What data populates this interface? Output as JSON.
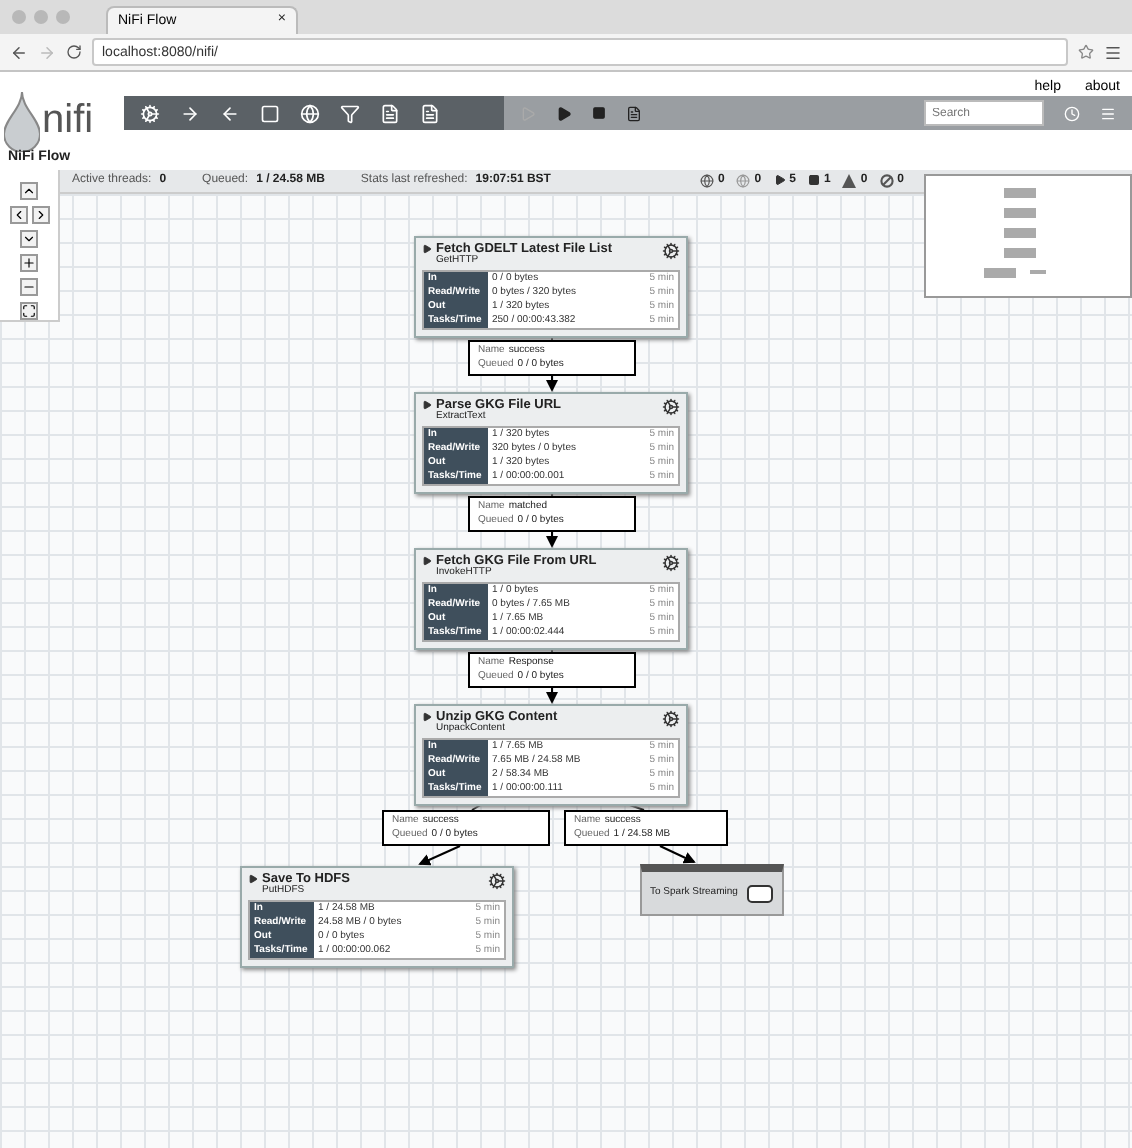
{
  "browser": {
    "tab_title": "NiFi Flow",
    "tab_close": "×",
    "url": "localhost:8080/nifi/"
  },
  "header": {
    "logo_text": "nifi",
    "flow_name": "NiFi Flow",
    "links": [
      "help",
      "about"
    ],
    "search": {
      "placeholder": "Search"
    }
  },
  "status_bar": {
    "active_threads_label": "Active threads:",
    "active_threads": "0",
    "queued_label": "Queued:",
    "queued": "1 / 24.58 MB",
    "refreshed_label": "Stats last refreshed:",
    "refreshed": "19:07:51 BST",
    "counts": [
      {
        "kind": "transmitting",
        "value": "0"
      },
      {
        "kind": "not-transmitting",
        "value": "0"
      },
      {
        "kind": "running",
        "value": "5"
      },
      {
        "kind": "stopped",
        "value": "1"
      },
      {
        "kind": "invalid",
        "value": "0"
      },
      {
        "kind": "disabled",
        "value": "0"
      }
    ]
  },
  "processors": [
    {
      "name": "Fetch GDELT Latest File List",
      "type": "GetHTTP",
      "stats": [
        {
          "label": "In",
          "value": "0 / 0 bytes",
          "window": "5 min"
        },
        {
          "label": "Read/Write",
          "value": "0 bytes / 320 bytes",
          "window": "5 min"
        },
        {
          "label": "Out",
          "value": "1 / 320 bytes",
          "window": "5 min"
        },
        {
          "label": "Tasks/Time",
          "value": "250 / 00:00:43.382",
          "window": "5 min"
        }
      ]
    },
    {
      "name": "Parse GKG File URL",
      "type": "ExtractText",
      "stats": [
        {
          "label": "In",
          "value": "1 / 320 bytes",
          "window": "5 min"
        },
        {
          "label": "Read/Write",
          "value": "320 bytes / 0 bytes",
          "window": "5 min"
        },
        {
          "label": "Out",
          "value": "1 / 320 bytes",
          "window": "5 min"
        },
        {
          "label": "Tasks/Time",
          "value": "1 / 00:00:00.001",
          "window": "5 min"
        }
      ]
    },
    {
      "name": "Fetch GKG File From URL",
      "type": "InvokeHTTP",
      "stats": [
        {
          "label": "In",
          "value": "1 / 0 bytes",
          "window": "5 min"
        },
        {
          "label": "Read/Write",
          "value": "0 bytes / 7.65 MB",
          "window": "5 min"
        },
        {
          "label": "Out",
          "value": "1 / 7.65 MB",
          "window": "5 min"
        },
        {
          "label": "Tasks/Time",
          "value": "1 / 00:00:02.444",
          "window": "5 min"
        }
      ]
    },
    {
      "name": "Unzip GKG Content",
      "type": "UnpackContent",
      "stats": [
        {
          "label": "In",
          "value": "1 / 7.65 MB",
          "window": "5 min"
        },
        {
          "label": "Read/Write",
          "value": "7.65 MB / 24.58 MB",
          "window": "5 min"
        },
        {
          "label": "Out",
          "value": "2 / 58.34 MB",
          "window": "5 min"
        },
        {
          "label": "Tasks/Time",
          "value": "1 / 00:00:00.111",
          "window": "5 min"
        }
      ]
    },
    {
      "name": "Save To HDFS",
      "type": "PutHDFS",
      "stats": [
        {
          "label": "In",
          "value": "1 / 24.58 MB",
          "window": "5 min"
        },
        {
          "label": "Read/Write",
          "value": "24.58 MB / 0 bytes",
          "window": "5 min"
        },
        {
          "label": "Out",
          "value": "0 / 0 bytes",
          "window": "5 min"
        },
        {
          "label": "Tasks/Time",
          "value": "1 / 00:00:00.062",
          "window": "5 min"
        }
      ]
    }
  ],
  "connections": [
    {
      "name_label": "Name",
      "name": "success",
      "queued_label": "Queued",
      "queued": "0 / 0 bytes"
    },
    {
      "name_label": "Name",
      "name": "matched",
      "queued_label": "Queued",
      "queued": "0 / 0 bytes"
    },
    {
      "name_label": "Name",
      "name": "Response",
      "queued_label": "Queued",
      "queued": "0 / 0 bytes"
    },
    {
      "name_label": "Name",
      "name": "success",
      "queued_label": "Queued",
      "queued": "0 / 0 bytes"
    },
    {
      "name_label": "Name",
      "name": "success",
      "queued_label": "Queued",
      "queued": "1 / 24.58 MB"
    }
  ],
  "output_port": {
    "name": "To Spark Streaming"
  }
}
